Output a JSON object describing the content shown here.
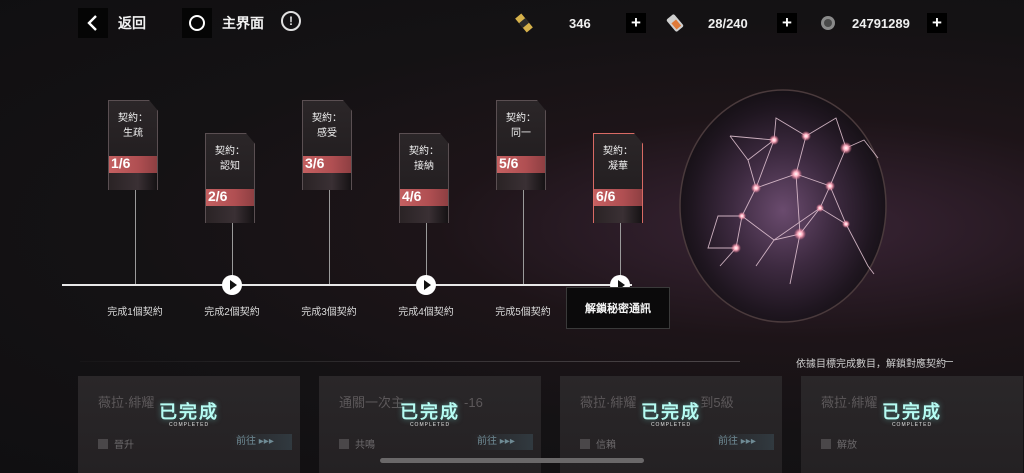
{
  "header": {
    "back_label": "返回",
    "home_label": "主界面",
    "info_symbol": "!",
    "resources": [
      {
        "icon": "ticket-icon",
        "value": "346"
      },
      {
        "icon": "battery-icon",
        "value": "28/240"
      },
      {
        "icon": "coin-icon",
        "value": "24791289"
      }
    ],
    "plus_symbol": "+"
  },
  "contracts": [
    {
      "name": "契約：\n生疏",
      "progress": "1/6",
      "active": false
    },
    {
      "name": "契約：\n認知",
      "progress": "2/6",
      "active": false
    },
    {
      "name": "契約：\n感受",
      "progress": "3/6",
      "active": false
    },
    {
      "name": "契約：\n接納",
      "progress": "4/6",
      "active": false
    },
    {
      "name": "契約：\n同一",
      "progress": "5/6",
      "active": false
    },
    {
      "name": "契約：\n凝華",
      "progress": "6/6",
      "active": true
    }
  ],
  "timeline": {
    "steps": [
      "完成1個契約",
      "完成2個契約",
      "完成3個契約",
      "完成4個契約",
      "完成5個契約"
    ],
    "unlock_label": "解鎖秘密通訊"
  },
  "bottom": {
    "hint": "依據目標完成數目，解鎖對應契約",
    "tasks": [
      {
        "title": "薇拉·緋耀",
        "status": "已完成",
        "status_en": "COMPLETED",
        "category": "晉升",
        "go": "前往 ▸▸▸"
      },
      {
        "title": "通關一次主",
        "title_suffix": "-16",
        "status": "已完成",
        "status_en": "COMPLETED",
        "category": "共鳴",
        "go": "前往 ▸▸▸"
      },
      {
        "title": "薇拉·緋耀",
        "title_suffix": "到5級",
        "status": "已完成",
        "status_en": "COMPLETED",
        "category": "信賴",
        "go": "前往 ▸▸▸"
      },
      {
        "title": "薇拉·緋耀",
        "status": "已完成",
        "status_en": "COMPLETED",
        "category": "解放",
        "go": ""
      }
    ]
  },
  "colors": {
    "accent_red": "#c46061",
    "completed_cyan": "#b6fcf3",
    "background": "#141214"
  }
}
